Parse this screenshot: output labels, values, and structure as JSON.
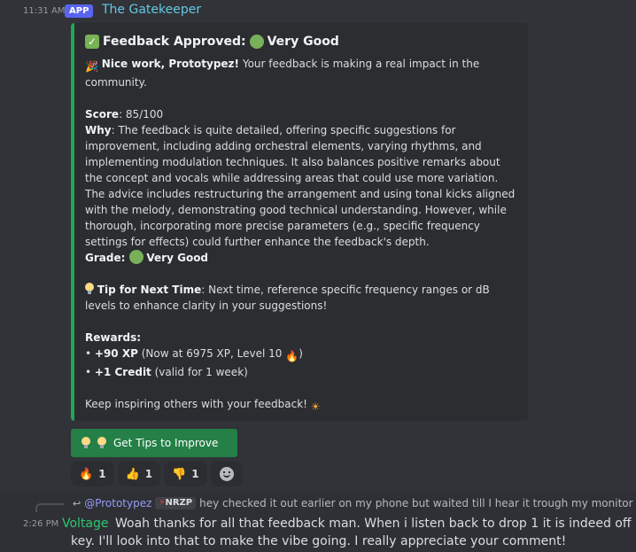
{
  "message1": {
    "time": "11:31 AM",
    "badge": "APP",
    "author": "The Gatekeeper",
    "author_color": "#64c7e4",
    "embed": {
      "accent": "#23a55a",
      "title_prefix": "Feedback Approved:",
      "title_suffix": "Very Good",
      "intro_bold": "Nice work, Prototypez!",
      "intro_rest": " Your feedback is making a real impact in the community.",
      "score_label": "Score",
      "score_value": ": 85/100",
      "why_label": "Why",
      "why_text": ": The feedback is quite detailed, offering specific suggestions for improvement, including adding orchestral elements, varying rhythms, and implementing modulation techniques. It also balances positive remarks about the concept and vocals while addressing areas that could use more variation. The advice includes restructuring the arrangement and using tonal kicks aligned with the melody, demonstrating good technical understanding. However, while thorough, incorporating more precise parameters (e.g., specific frequency settings for effects) could further enhance the feedback's depth.",
      "grade_label": "Grade",
      "grade_value": "Very Good",
      "tip_label": "Tip for Next Time",
      "tip_text": ": Next time, reference specific frequency ranges or dB levels to enhance clarity in your suggestions!",
      "rewards_label": "Rewards",
      "reward1_bold": "+90 XP",
      "reward1_rest": " (Now at 6975 XP, Level 10 ",
      "reward1_end": ")",
      "reward2_bold": "+1 Credit",
      "reward2_rest": " (valid for 1 week)",
      "closing": "Keep inspiring others with your feedback!"
    },
    "button_label": "Get Tips to Improve",
    "reactions": [
      {
        "emoji": "fire",
        "count": "1"
      },
      {
        "emoji": "thumbs-up",
        "count": "1"
      },
      {
        "emoji": "thumbs-down",
        "count": "1"
      }
    ]
  },
  "message2": {
    "time": "2:26 PM",
    "reply_mention": "@Prototypez",
    "reply_tag": "NRZP",
    "reply_preview": "hey checked it out earlier on my phone but waited till I hear it trough my monitor",
    "author": "Voltage",
    "author_color": "#2dc770",
    "text": "Woah thanks for all that feedback man. When i listen back to drop 1 it is indeed off key. I'll look into that to make the vibe going. I really appreciate your comment!"
  }
}
